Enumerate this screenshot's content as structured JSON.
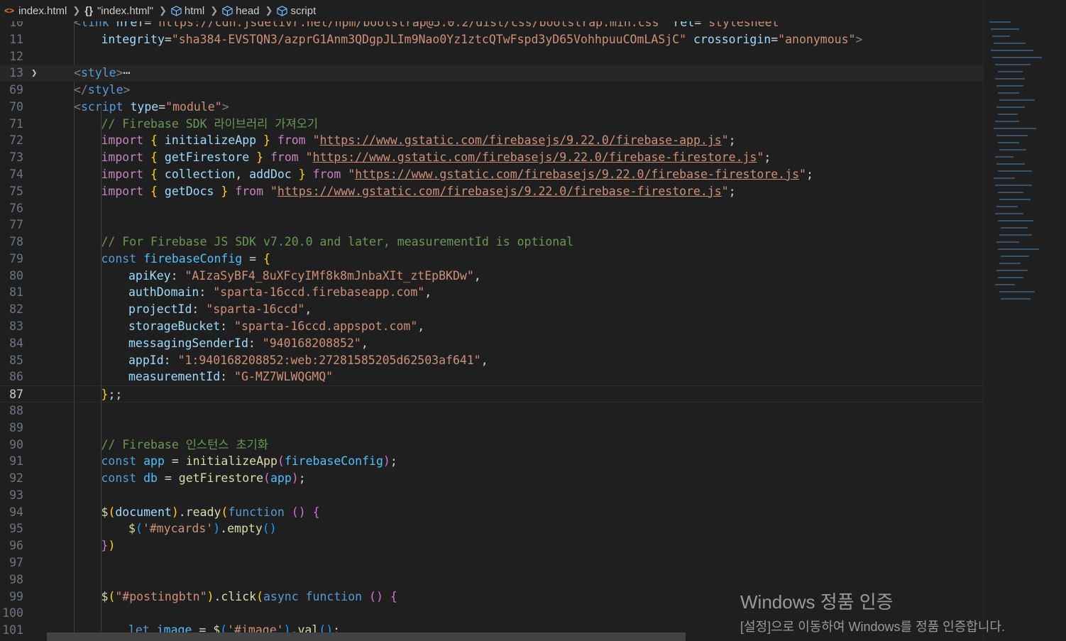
{
  "breadcrumb": {
    "file": "index.html",
    "symbol": "\"index.html\"",
    "items": [
      "html",
      "head",
      "script"
    ]
  },
  "lines": [
    {
      "n": "10",
      "tokens": [
        [
          "t-tag",
          "<"
        ],
        [
          "t-tagname",
          "link"
        ],
        [
          "t-def",
          " "
        ],
        [
          "t-attr",
          "href"
        ],
        [
          "t-def",
          "="
        ],
        [
          "t-str",
          "\"https://cdn.jsdelivr.net/npm/bootstrap@5.0.2/dist/css/bootstrap.min.css\""
        ],
        [
          "t-def",
          " "
        ],
        [
          "t-attr",
          "rel"
        ],
        [
          "t-def",
          "="
        ],
        [
          "t-str",
          "\"stylesheet\""
        ]
      ],
      "indent": 0
    },
    {
      "n": "11",
      "tokens": [
        [
          "t-attr",
          "integrity"
        ],
        [
          "t-def",
          "="
        ],
        [
          "t-str",
          "\"sha384-EVSTQN3/azprG1Anm3QDgpJLIm9Nao0Yz1ztcQTwFspd3yD65VohhpuuCOmLASjC\""
        ],
        [
          "t-def",
          " "
        ],
        [
          "t-attr",
          "crossorigin"
        ],
        [
          "t-def",
          "="
        ],
        [
          "t-str",
          "\"anonymous\""
        ],
        [
          "t-tag",
          ">"
        ]
      ],
      "indent": 1
    },
    {
      "n": "12",
      "tokens": [],
      "indent": 0
    },
    {
      "n": "13",
      "tokens": [
        [
          "t-tag",
          "<"
        ],
        [
          "t-tagname",
          "style"
        ],
        [
          "t-tag",
          ">"
        ],
        [
          "t-def",
          "⋯"
        ]
      ],
      "indent": 0,
      "folded": true
    },
    {
      "n": "69",
      "tokens": [
        [
          "t-tag",
          "</"
        ],
        [
          "t-tagname",
          "style"
        ],
        [
          "t-tag",
          ">"
        ]
      ],
      "indent": 0
    },
    {
      "n": "70",
      "tokens": [
        [
          "t-tag",
          "<"
        ],
        [
          "t-tagname",
          "script"
        ],
        [
          "t-def",
          " "
        ],
        [
          "t-attr",
          "type"
        ],
        [
          "t-def",
          "="
        ],
        [
          "t-str",
          "\"module\""
        ],
        [
          "t-tag",
          ">"
        ]
      ],
      "indent": 0
    },
    {
      "n": "71",
      "tokens": [
        [
          "t-com",
          "// Firebase SDK 라이브러리 가져오기"
        ]
      ],
      "indent": 1
    },
    {
      "n": "72",
      "tokens": [
        [
          "t-kw",
          "import"
        ],
        [
          "t-def",
          " "
        ],
        [
          "t-b1",
          "{"
        ],
        [
          "t-def",
          " "
        ],
        [
          "t-prop",
          "initializeApp"
        ],
        [
          "t-def",
          " "
        ],
        [
          "t-b1",
          "}"
        ],
        [
          "t-def",
          " "
        ],
        [
          "t-kw",
          "from"
        ],
        [
          "t-def",
          " "
        ],
        [
          "t-str",
          "\""
        ],
        [
          "t-url",
          "https://www.gstatic.com/firebasejs/9.22.0/firebase-app.js"
        ],
        [
          "t-str",
          "\""
        ],
        [
          "t-def",
          ";"
        ]
      ],
      "indent": 1
    },
    {
      "n": "73",
      "tokens": [
        [
          "t-kw",
          "import"
        ],
        [
          "t-def",
          " "
        ],
        [
          "t-b1",
          "{"
        ],
        [
          "t-def",
          " "
        ],
        [
          "t-prop",
          "getFirestore"
        ],
        [
          "t-def",
          " "
        ],
        [
          "t-b1",
          "}"
        ],
        [
          "t-def",
          " "
        ],
        [
          "t-kw",
          "from"
        ],
        [
          "t-def",
          " "
        ],
        [
          "t-str",
          "\""
        ],
        [
          "t-url",
          "https://www.gstatic.com/firebasejs/9.22.0/firebase-firestore.js"
        ],
        [
          "t-str",
          "\""
        ],
        [
          "t-def",
          ";"
        ]
      ],
      "indent": 1
    },
    {
      "n": "74",
      "tokens": [
        [
          "t-kw",
          "import"
        ],
        [
          "t-def",
          " "
        ],
        [
          "t-b1",
          "{"
        ],
        [
          "t-def",
          " "
        ],
        [
          "t-prop",
          "collection"
        ],
        [
          "t-def",
          ", "
        ],
        [
          "t-prop",
          "addDoc"
        ],
        [
          "t-def",
          " "
        ],
        [
          "t-b1",
          "}"
        ],
        [
          "t-def",
          " "
        ],
        [
          "t-kw",
          "from"
        ],
        [
          "t-def",
          " "
        ],
        [
          "t-str",
          "\""
        ],
        [
          "t-url",
          "https://www.gstatic.com/firebasejs/9.22.0/firebase-firestore.js"
        ],
        [
          "t-str",
          "\""
        ],
        [
          "t-def",
          ";"
        ]
      ],
      "indent": 1
    },
    {
      "n": "75",
      "tokens": [
        [
          "t-kw",
          "import"
        ],
        [
          "t-def",
          " "
        ],
        [
          "t-b1",
          "{"
        ],
        [
          "t-def",
          " "
        ],
        [
          "t-prop",
          "getDocs"
        ],
        [
          "t-def",
          " "
        ],
        [
          "t-b1",
          "}"
        ],
        [
          "t-def",
          " "
        ],
        [
          "t-kw",
          "from"
        ],
        [
          "t-def",
          " "
        ],
        [
          "t-str",
          "\""
        ],
        [
          "t-url",
          "https://www.gstatic.com/firebasejs/9.22.0/firebase-firestore.js"
        ],
        [
          "t-str",
          "\""
        ],
        [
          "t-def",
          ";"
        ]
      ],
      "indent": 1
    },
    {
      "n": "76",
      "tokens": [],
      "indent": 0
    },
    {
      "n": "77",
      "tokens": [],
      "indent": 0
    },
    {
      "n": "78",
      "tokens": [
        [
          "t-com",
          "// For Firebase JS SDK v7.20.0 and later, measurementId is optional"
        ]
      ],
      "indent": 1
    },
    {
      "n": "79",
      "tokens": [
        [
          "t-kw2",
          "const"
        ],
        [
          "t-def",
          " "
        ],
        [
          "t-var",
          "firebaseConfig"
        ],
        [
          "t-def",
          " = "
        ],
        [
          "t-b1",
          "{"
        ]
      ],
      "indent": 1
    },
    {
      "n": "80",
      "tokens": [
        [
          "t-prop",
          "apiKey"
        ],
        [
          "t-def",
          ": "
        ],
        [
          "t-str",
          "\"AIzaSyBF4_8uXFcyIMf8k8mJnbaXIt_ztEpBKDw\""
        ],
        [
          "t-def",
          ","
        ]
      ],
      "indent": 2
    },
    {
      "n": "81",
      "tokens": [
        [
          "t-prop",
          "authDomain"
        ],
        [
          "t-def",
          ": "
        ],
        [
          "t-str",
          "\"sparta-16ccd.firebaseapp.com\""
        ],
        [
          "t-def",
          ","
        ]
      ],
      "indent": 2
    },
    {
      "n": "82",
      "tokens": [
        [
          "t-prop",
          "projectId"
        ],
        [
          "t-def",
          ": "
        ],
        [
          "t-str",
          "\"sparta-16ccd\""
        ],
        [
          "t-def",
          ","
        ]
      ],
      "indent": 2
    },
    {
      "n": "83",
      "tokens": [
        [
          "t-prop",
          "storageBucket"
        ],
        [
          "t-def",
          ": "
        ],
        [
          "t-str",
          "\"sparta-16ccd.appspot.com\""
        ],
        [
          "t-def",
          ","
        ]
      ],
      "indent": 2
    },
    {
      "n": "84",
      "tokens": [
        [
          "t-prop",
          "messagingSenderId"
        ],
        [
          "t-def",
          ": "
        ],
        [
          "t-str",
          "\"940168208852\""
        ],
        [
          "t-def",
          ","
        ]
      ],
      "indent": 2
    },
    {
      "n": "85",
      "tokens": [
        [
          "t-prop",
          "appId"
        ],
        [
          "t-def",
          ": "
        ],
        [
          "t-str",
          "\"1:940168208852:web:27281585205d62503af641\""
        ],
        [
          "t-def",
          ","
        ]
      ],
      "indent": 2
    },
    {
      "n": "86",
      "tokens": [
        [
          "t-prop",
          "measurementId"
        ],
        [
          "t-def",
          ": "
        ],
        [
          "t-str",
          "\"G-MZ7WLWQGMQ\""
        ]
      ],
      "indent": 2
    },
    {
      "n": "87",
      "tokens": [
        [
          "t-b1",
          "}"
        ],
        [
          "t-def",
          ";;"
        ]
      ],
      "indent": 1,
      "current": true
    },
    {
      "n": "88",
      "tokens": [],
      "indent": 0
    },
    {
      "n": "89",
      "tokens": [],
      "indent": 0
    },
    {
      "n": "90",
      "tokens": [
        [
          "t-com",
          "// Firebase 인스턴스 초기화"
        ]
      ],
      "indent": 1
    },
    {
      "n": "91",
      "tokens": [
        [
          "t-kw2",
          "const"
        ],
        [
          "t-def",
          " "
        ],
        [
          "t-var",
          "app"
        ],
        [
          "t-def",
          " = "
        ],
        [
          "t-fn",
          "initializeApp"
        ],
        [
          "t-b2",
          "("
        ],
        [
          "t-var",
          "firebaseConfig"
        ],
        [
          "t-b2",
          ")"
        ],
        [
          "t-def",
          ";"
        ]
      ],
      "indent": 1
    },
    {
      "n": "92",
      "tokens": [
        [
          "t-kw2",
          "const"
        ],
        [
          "t-def",
          " "
        ],
        [
          "t-var",
          "db"
        ],
        [
          "t-def",
          " = "
        ],
        [
          "t-fn",
          "getFirestore"
        ],
        [
          "t-b2",
          "("
        ],
        [
          "t-var",
          "app"
        ],
        [
          "t-b2",
          ")"
        ],
        [
          "t-def",
          ";"
        ]
      ],
      "indent": 1
    },
    {
      "n": "93",
      "tokens": [],
      "indent": 0
    },
    {
      "n": "94",
      "tokens": [
        [
          "t-fn",
          "$"
        ],
        [
          "t-b1",
          "("
        ],
        [
          "t-prop",
          "document"
        ],
        [
          "t-b1",
          ")"
        ],
        [
          "t-def",
          "."
        ],
        [
          "t-fn",
          "ready"
        ],
        [
          "t-b1",
          "("
        ],
        [
          "t-kw2",
          "function"
        ],
        [
          "t-def",
          " "
        ],
        [
          "t-b2",
          "()"
        ],
        [
          "t-def",
          " "
        ],
        [
          "t-b2",
          "{"
        ]
      ],
      "indent": 1
    },
    {
      "n": "95",
      "tokens": [
        [
          "t-fn",
          "$"
        ],
        [
          "t-b3",
          "("
        ],
        [
          "t-str",
          "'#mycards'"
        ],
        [
          "t-b3",
          ")"
        ],
        [
          "t-def",
          "."
        ],
        [
          "t-fn",
          "empty"
        ],
        [
          "t-b3",
          "()"
        ]
      ],
      "indent": 2
    },
    {
      "n": "96",
      "tokens": [
        [
          "t-b2",
          "}"
        ],
        [
          "t-b1",
          ")"
        ]
      ],
      "indent": 1
    },
    {
      "n": "97",
      "tokens": [],
      "indent": 0
    },
    {
      "n": "98",
      "tokens": [],
      "indent": 0
    },
    {
      "n": "99",
      "tokens": [
        [
          "t-fn",
          "$"
        ],
        [
          "t-b1",
          "("
        ],
        [
          "t-str",
          "\"#postingbtn\""
        ],
        [
          "t-b1",
          ")"
        ],
        [
          "t-def",
          "."
        ],
        [
          "t-fn",
          "click"
        ],
        [
          "t-b1",
          "("
        ],
        [
          "t-kw2",
          "async"
        ],
        [
          "t-def",
          " "
        ],
        [
          "t-kw2",
          "function"
        ],
        [
          "t-def",
          " "
        ],
        [
          "t-b2",
          "()"
        ],
        [
          "t-def",
          " "
        ],
        [
          "t-b2",
          "{"
        ]
      ],
      "indent": 1
    },
    {
      "n": "100",
      "tokens": [],
      "indent": 0
    },
    {
      "n": "101",
      "tokens": [
        [
          "t-kw2",
          "let"
        ],
        [
          "t-def",
          " "
        ],
        [
          "t-var",
          "image"
        ],
        [
          "t-def",
          " = "
        ],
        [
          "t-fn",
          "$"
        ],
        [
          "t-b3",
          "("
        ],
        [
          "t-str",
          "'#image'"
        ],
        [
          "t-b3",
          ")"
        ],
        [
          "t-def",
          "."
        ],
        [
          "t-fn",
          "val"
        ],
        [
          "t-b3",
          "()"
        ],
        [
          "t-def",
          ";"
        ]
      ],
      "indent": 2
    }
  ],
  "watermark": {
    "title": "Windows 정품 인증",
    "subtitle": "[설정]으로 이동하여 Windows를 정품 인증합니다."
  },
  "colors": {
    "background": "#1f1f1f",
    "string": "#ce9178",
    "comment": "#6a9955",
    "keyword": "#c586c0",
    "tag": "#569cd6"
  }
}
